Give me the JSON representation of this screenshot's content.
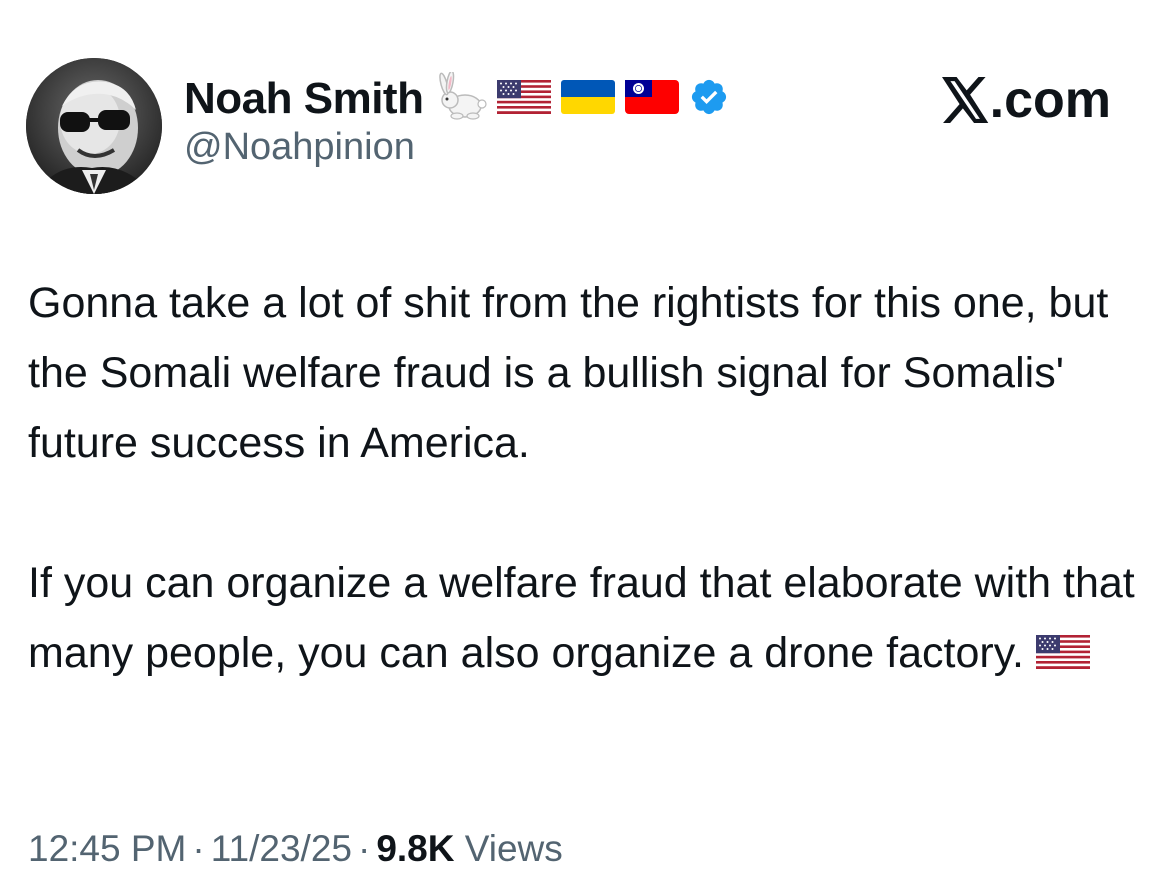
{
  "author": {
    "display_name": "Noah Smith",
    "handle": "@Noahpinion",
    "badges": [
      "rabbit-emoji",
      "us-flag-emoji",
      "ukraine-flag-emoji",
      "taiwan-flag-emoji",
      "verified-badge-icon"
    ],
    "verified_color": "#1d9bf0"
  },
  "brand": {
    "label": ".com",
    "logo": "x-logo-icon"
  },
  "tweet": {
    "paragraph_1": "Gonna take a lot of shit from the rightists for this one, but the Somali welfare fraud is a bullish signal for Somalis' future success in America.",
    "paragraph_2": "If you can organize a welfare fraud that elaborate with that many people, you can also organize a drone factory.",
    "trailing_emoji": "us-flag-emoji"
  },
  "meta": {
    "time": "12:45 PM",
    "date": "11/23/25",
    "views_count": "9.8K",
    "views_label": "Views",
    "separator": "·"
  },
  "colors": {
    "text_primary": "#0f1419",
    "text_secondary": "#536471",
    "background": "#ffffff"
  }
}
